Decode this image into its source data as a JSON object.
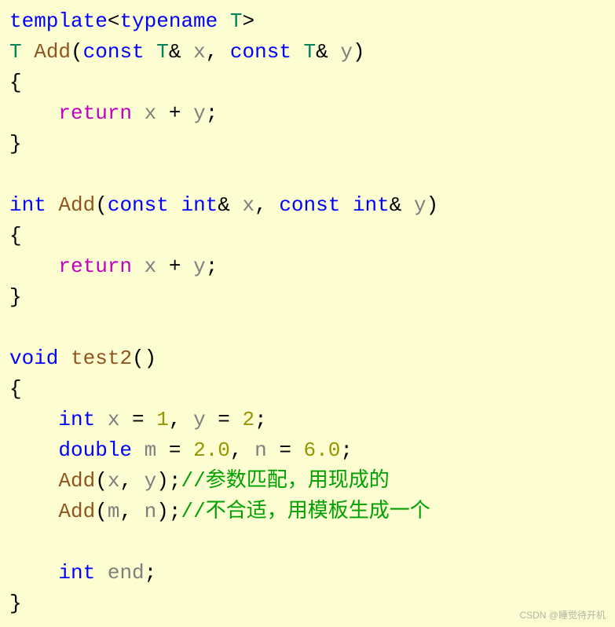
{
  "code": {
    "l1": {
      "kw1": "template",
      "lt": "<",
      "kw2": "typename",
      "sp": " ",
      "t": "T",
      "gt": ">"
    },
    "l2": {
      "t1": "T",
      "sp1": " ",
      "fn": "Add",
      "p1": "(",
      "kw1": "const",
      "sp2": " ",
      "t2": "T",
      "amp1": "& ",
      "v1": "x",
      "c1": ", ",
      "kw2": "const",
      "sp3": " ",
      "t3": "T",
      "amp2": "& ",
      "v2": "y",
      "p2": ")"
    },
    "l3": {
      "brace": "{"
    },
    "l4": {
      "indent": "    ",
      "ret": "return",
      "sp": " ",
      "v1": "x",
      "op": " + ",
      "v2": "y",
      "semi": ";"
    },
    "l5": {
      "brace": "}"
    },
    "l6": {
      "blank": " "
    },
    "l7": {
      "kw1": "int",
      "sp": " ",
      "fn": "Add",
      "p1": "(",
      "kw2": "const",
      "sp2": " ",
      "kw3": "int",
      "amp1": "& ",
      "v1": "x",
      "c1": ", ",
      "kw4": "const",
      "sp3": " ",
      "kw5": "int",
      "amp2": "& ",
      "v2": "y",
      "p2": ")"
    },
    "l8": {
      "brace": "{"
    },
    "l9": {
      "indent": "    ",
      "ret": "return",
      "sp": " ",
      "v1": "x",
      "op": " + ",
      "v2": "y",
      "semi": ";"
    },
    "l10": {
      "brace": "}"
    },
    "l11": {
      "blank": " "
    },
    "l12": {
      "kw1": "void",
      "sp": " ",
      "fn": "test2",
      "pp": "()"
    },
    "l13": {
      "brace": "{"
    },
    "l14": {
      "indent": "    ",
      "kw1": "int",
      "sp1": " ",
      "v1": "x",
      "op1": " = ",
      "n1": "1",
      "c1": ", ",
      "v2": "y",
      "op2": " = ",
      "n2": "2",
      "semi": ";"
    },
    "l15": {
      "indent": "    ",
      "kw1": "double",
      "sp1": " ",
      "v1": "m",
      "op1": " = ",
      "n1": "2.0",
      "c1": ", ",
      "v2": "n",
      "op2": " = ",
      "n2": "6.0",
      "semi": ";"
    },
    "l16": {
      "indent": "    ",
      "fn": "Add",
      "p1": "(",
      "v1": "x",
      "c1": ", ",
      "v2": "y",
      "p2": ");",
      "comment": "//参数匹配，用现成的"
    },
    "l17": {
      "indent": "    ",
      "fn": "Add",
      "p1": "(",
      "v1": "m",
      "c1": ", ",
      "v2": "n",
      "p2": ");",
      "comment": "//不合适，用模板生成一个"
    },
    "l18": {
      "blank": " "
    },
    "l19": {
      "indent": "    ",
      "kw1": "int",
      "sp1": " ",
      "v1": "end",
      "semi": ";"
    },
    "l20": {
      "brace": "}"
    }
  },
  "watermark": "CSDN @睡觉待开机"
}
